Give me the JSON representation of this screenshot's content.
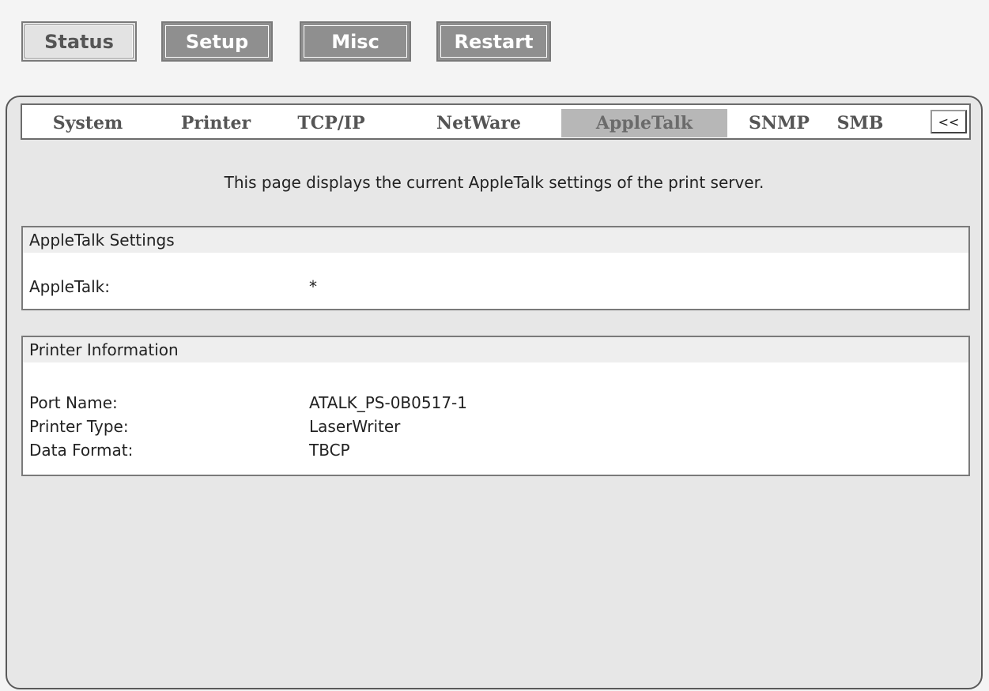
{
  "top_nav": {
    "status": "Status",
    "setup": "Setup",
    "misc": "Misc",
    "restart": "Restart"
  },
  "tabs": {
    "system": "System",
    "printer": "Printer",
    "tcpip": "TCP/IP",
    "netware": "NetWare",
    "appletalk": "AppleTalk",
    "snmp": "SNMP",
    "smb": "SMB",
    "collapse": "<<"
  },
  "intro": "This page displays the current AppleTalk settings of the print server.",
  "appletalk_settings": {
    "title": "AppleTalk Settings",
    "appletalk_label": "AppleTalk:",
    "appletalk_value": "*"
  },
  "printer_info": {
    "title": "Printer Information",
    "port_name_label": "Port Name:",
    "port_name_value": "ATALK_PS-0B0517-1",
    "printer_type_label": "Printer Type:",
    "printer_type_value": "LaserWriter",
    "data_format_label": "Data Format:",
    "data_format_value": "TBCP"
  }
}
